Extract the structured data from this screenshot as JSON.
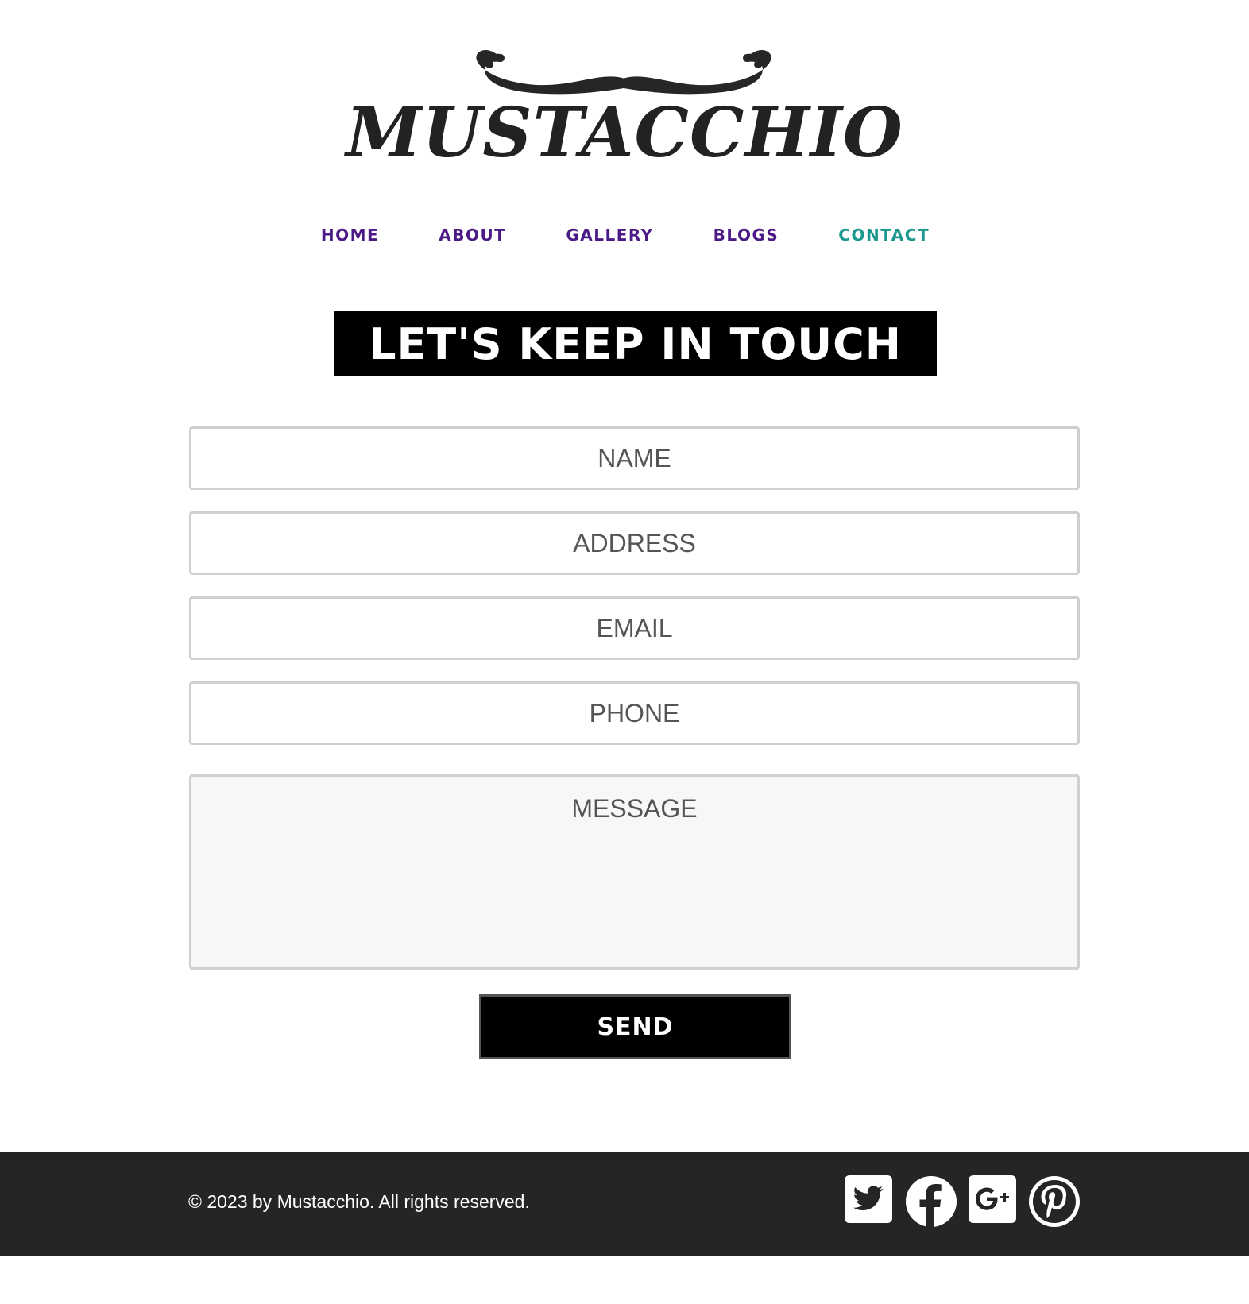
{
  "logo": {
    "text": "MUSTACCHIO"
  },
  "nav": {
    "items": [
      "HOME",
      "ABOUT",
      "GALLERY",
      "BLOGS",
      "CONTACT"
    ],
    "active": "CONTACT"
  },
  "page": {
    "title": "LET'S KEEP IN TOUCH"
  },
  "form": {
    "name_placeholder": "NAME",
    "address_placeholder": "ADDRESS",
    "email_placeholder": "EMAIL",
    "phone_placeholder": "PHONE",
    "message_placeholder": "MESSAGE",
    "send_label": "SEND"
  },
  "footer": {
    "copyright": "© 2023 by Mustacchio. All rights reserved.",
    "social": [
      "twitter-icon",
      "facebook-icon",
      "google-plus-icon",
      "pinterest-icon"
    ]
  },
  "colors": {
    "nav": "#4b1a87",
    "nav_active": "#1a978f",
    "footer_bg": "#252525"
  }
}
